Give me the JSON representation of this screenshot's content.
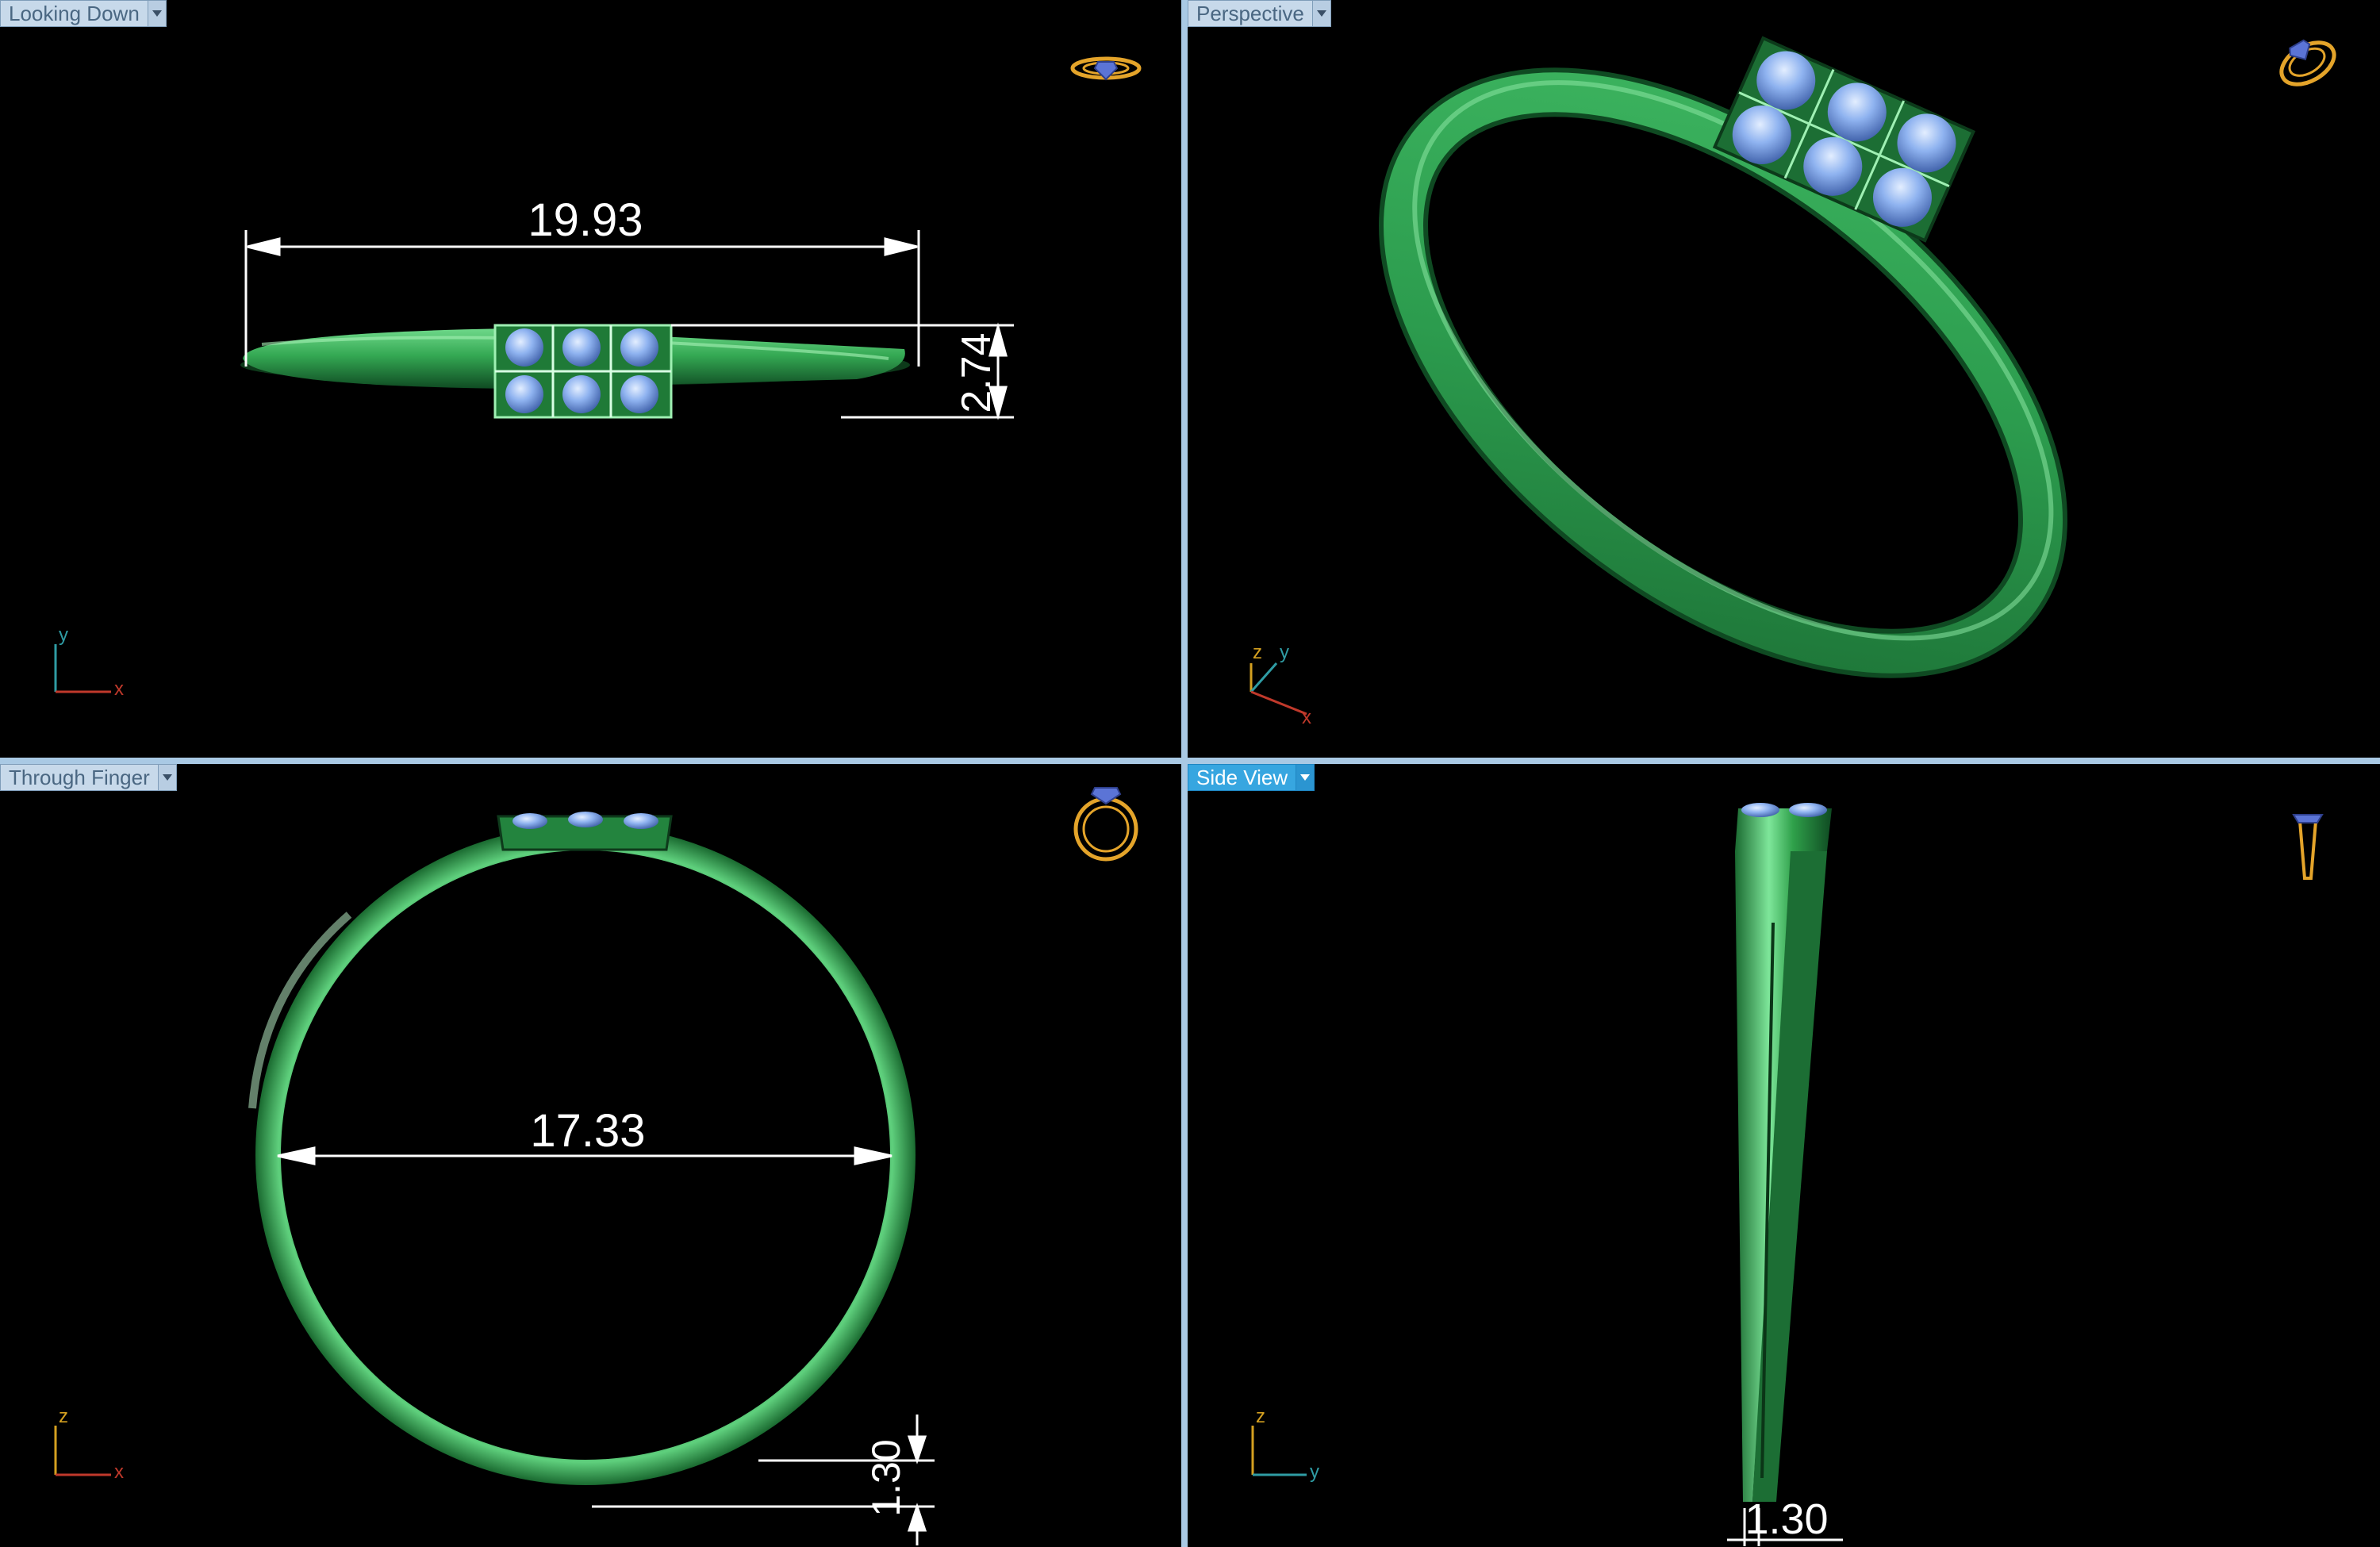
{
  "viewports": {
    "top_left": {
      "title": "Looking Down",
      "dimensions": {
        "width": "19.93",
        "height": "2.74"
      },
      "axes": {
        "vertical": "y",
        "horizontal": "x"
      }
    },
    "top_right": {
      "title": "Perspective",
      "axes": {
        "vertical": "z",
        "second": "y",
        "horizontal": "x"
      }
    },
    "bottom_left": {
      "title": "Through Finger",
      "dimensions": {
        "diameter": "17.33",
        "thickness": "1.30"
      },
      "axes": {
        "vertical": "z",
        "horizontal": "x"
      }
    },
    "bottom_right": {
      "title": "Side View",
      "dimensions": {
        "width": "1.30"
      },
      "axes": {
        "vertical": "z",
        "horizontal": "y"
      },
      "active": true
    }
  },
  "icons": {
    "view_cube_top_left": "ring-top-view-icon",
    "view_cube_top_right": "ring-perspective-icon",
    "view_cube_bottom_left": "ring-front-view-icon",
    "view_cube_bottom_right": "ring-side-view-icon",
    "dropdown": "chevron-down-icon"
  },
  "colors": {
    "ring_metal": "#2fa04a",
    "gem": "#7aa4e8",
    "dimension": "#ffffff",
    "viewport_bg": "#000000",
    "active_tab": "#37a6e0",
    "view_icon": "#e4a42a"
  }
}
